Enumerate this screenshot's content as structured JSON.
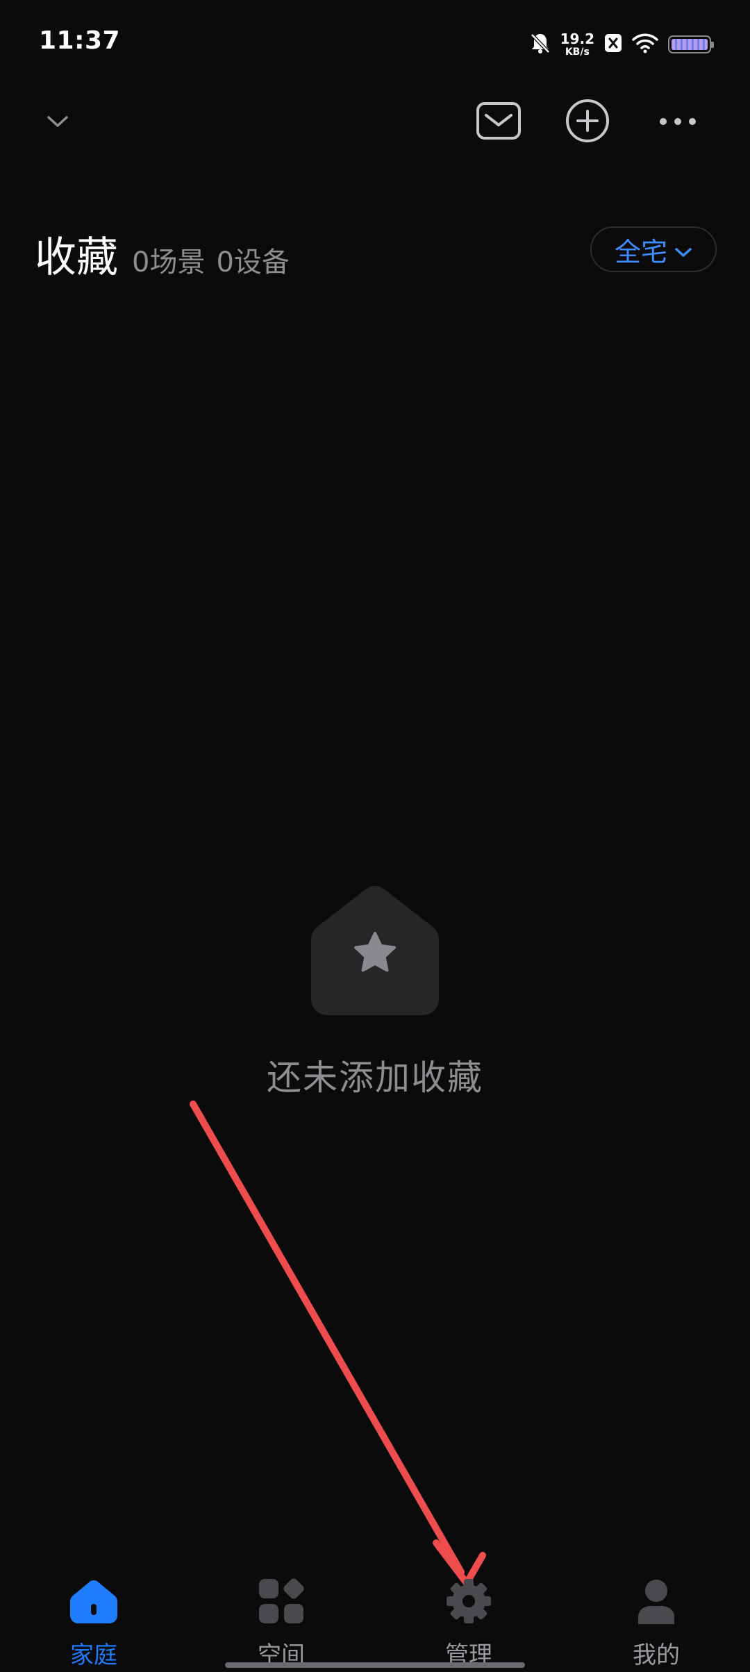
{
  "status_bar": {
    "time": "11:37",
    "net_speed_value": "19.2",
    "net_speed_unit": "KB/s",
    "icons": [
      "bell-muted-icon",
      "x-badge-icon",
      "wifi-icon",
      "battery-icon"
    ],
    "battery_level": 1.0
  },
  "top_bar": {
    "home_switch_icon": "chevron-down-icon",
    "actions": [
      "message-icon",
      "add-icon",
      "more-icon"
    ]
  },
  "favorites": {
    "title": "收藏",
    "scene_count": "0场景",
    "device_count": "0设备",
    "scope_label": "全宅"
  },
  "empty_state": {
    "icon": "house-star-icon",
    "text": "还未添加收藏"
  },
  "bottom_nav": {
    "active_index": 0,
    "items": [
      {
        "label": "家庭",
        "icon": "home-icon"
      },
      {
        "label": "空间",
        "icon": "space-grid-icon"
      },
      {
        "label": "管理",
        "icon": "gear-icon"
      },
      {
        "label": "我的",
        "icon": "person-icon"
      }
    ]
  },
  "colors": {
    "background": "#0b0b0c",
    "accent": "#1f7cff",
    "annotation_arrow": "#ef4d4d",
    "muted_text": "#8d8d92"
  }
}
